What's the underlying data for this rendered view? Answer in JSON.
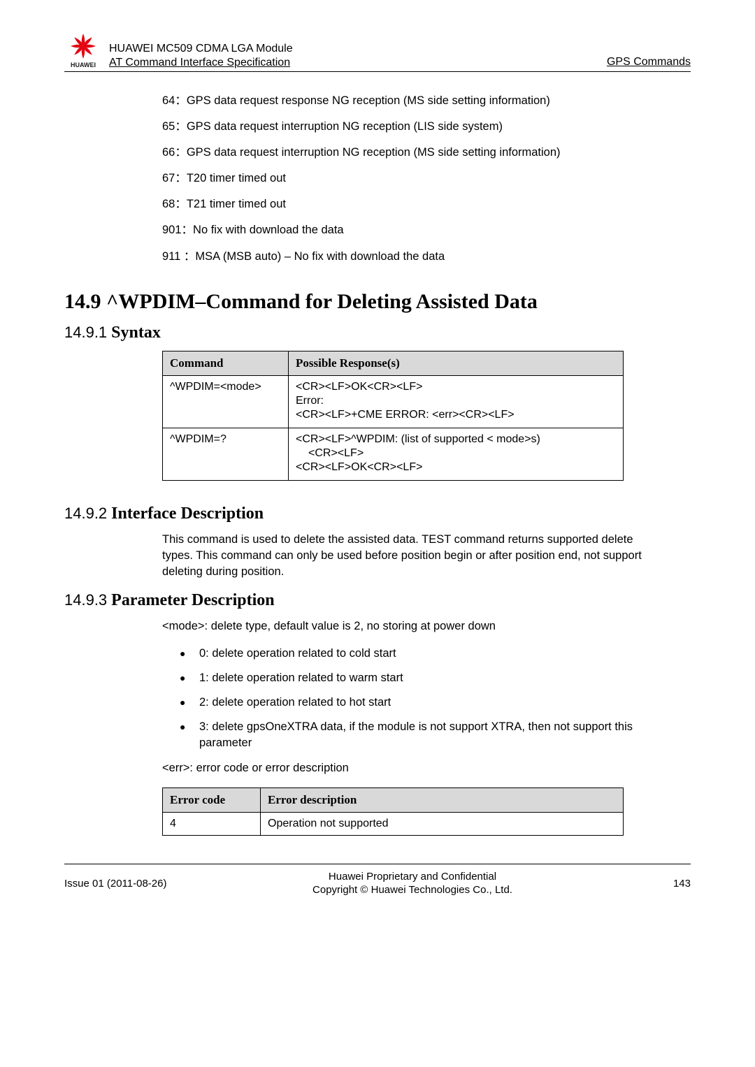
{
  "header": {
    "doc_line1": "HUAWEI MC509 CDMA LGA Module",
    "doc_line2_pre": "AT Command Interface Specification",
    "right_label": "GPS Commands",
    "logo_text": "HUAWEI"
  },
  "gps_items": [
    "64：GPS data request response NG reception (MS side setting information)",
    "65：GPS data request interruption NG reception (LIS side system)",
    "66：GPS data request interruption NG reception (MS side setting information)",
    "67：T20 timer timed out",
    "68：T21 timer timed out",
    "901：No fix with download the data",
    "911 ：MSA (MSB auto) – No fix with download the data"
  ],
  "section_14_9": {
    "title": "14.9 ^WPDIM–Command for Deleting Assisted Data"
  },
  "sub_14_9_1": {
    "num": "14.9.1",
    "txt": "Syntax",
    "th1": "Command",
    "th2": "Possible Response(s)",
    "rows": [
      {
        "c1": "^WPDIM=<mode>",
        "c2": [
          {
            "t": "<CR><LF>OK<CR><LF>",
            "indent": false
          },
          {
            "t": "Error:",
            "indent": false
          },
          {
            "t": "<CR><LF>+CME ERROR: <err><CR><LF>",
            "indent": false
          }
        ]
      },
      {
        "c1": "^WPDIM=?",
        "c2": [
          {
            "t": "<CR><LF>^WPDIM: (list of supported < mode>s)",
            "indent": false
          },
          {
            "t": "<CR><LF>",
            "indent": true
          },
          {
            "t": "<CR><LF>OK<CR><LF>",
            "indent": false
          }
        ]
      }
    ]
  },
  "sub_14_9_2": {
    "num": "14.9.2",
    "txt": "Interface Description",
    "desc": "This command is used to delete the assisted data. TEST command returns supported delete types. This command can only be used before position begin or after position end, not support deleting during position."
  },
  "sub_14_9_3": {
    "num": "14.9.3",
    "txt": "Parameter Description",
    "mode_line": "<mode>: delete type, default value is 2, no storing at power down",
    "bullets": [
      "0: delete operation related to cold start",
      "1: delete operation related to warm start",
      "2: delete operation related to hot start",
      "3: delete gpsOneXTRA data, if the module is not support XTRA, then not support this parameter"
    ],
    "err_line": "<err>: error code or error description",
    "err_th1": "Error code",
    "err_th2": "Error description",
    "err_rows": [
      {
        "c1": "4",
        "c2": "Operation not supported"
      }
    ]
  },
  "footer": {
    "left": "Issue 01 (2011-08-26)",
    "center1": "Huawei Proprietary and Confidential",
    "center2": "Copyright © Huawei Technologies Co., Ltd.",
    "right": "143"
  }
}
